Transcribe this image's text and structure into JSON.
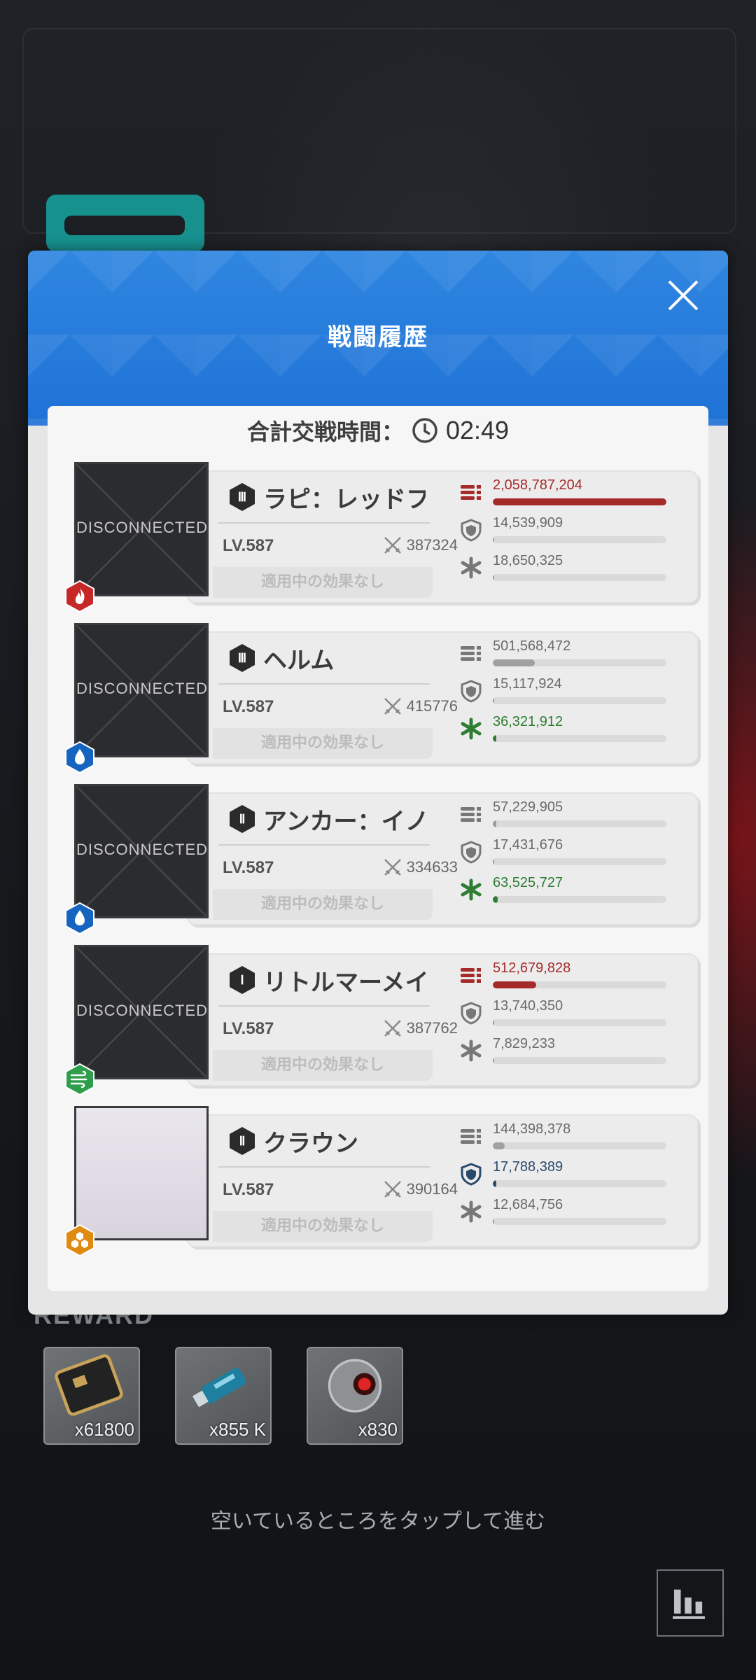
{
  "modal": {
    "title": "戦闘履歴",
    "total_time_label": "合計交戦時間：",
    "total_time_value": "02:49"
  },
  "characters": [
    {
      "name": "ラピ：レッドフ",
      "burst": "Ⅲ",
      "element": "fire",
      "level": "LV.587",
      "power": "387324",
      "effect": "適用中の効果なし",
      "portrait_status": "DISCONNECTED",
      "damage": "2,058,787,204",
      "damage_fraction": 1.0,
      "damage_taken": "14,539,909",
      "damage_taken_fraction": 0.0,
      "healing": "18,650,325",
      "healing_fraction": 0.0,
      "highlight": "damage"
    },
    {
      "name": "ヘルム",
      "burst": "Ⅲ",
      "element": "water",
      "level": "LV.587",
      "power": "415776",
      "effect": "適用中の効果なし",
      "portrait_status": "DISCONNECTED",
      "damage": "501,568,472",
      "damage_fraction": 0.24,
      "damage_taken": "15,117,924",
      "damage_taken_fraction": 0.0,
      "healing": "36,321,912",
      "healing_fraction": 0.01,
      "highlight": "healing"
    },
    {
      "name": "アンカー：イノ",
      "burst": "Ⅱ",
      "element": "water",
      "level": "LV.587",
      "power": "334633",
      "effect": "適用中の効果なし",
      "portrait_status": "DISCONNECTED",
      "damage": "57,229,905",
      "damage_fraction": 0.02,
      "damage_taken": "17,431,676",
      "damage_taken_fraction": 0.0,
      "healing": "63,525,727",
      "healing_fraction": 0.03,
      "highlight": "healing"
    },
    {
      "name": "リトルマーメイ",
      "burst": "Ⅰ",
      "element": "wind",
      "level": "LV.587",
      "power": "387762",
      "effect": "適用中の効果なし",
      "portrait_status": "DISCONNECTED",
      "damage": "512,679,828",
      "damage_fraction": 0.25,
      "damage_taken": "13,740,350",
      "damage_taken_fraction": 0.0,
      "healing": "7,829,233",
      "healing_fraction": 0.0,
      "highlight": "damage"
    },
    {
      "name": "クラウン",
      "burst": "Ⅱ",
      "element": "iron",
      "level": "LV.587",
      "power": "390164",
      "effect": "適用中の効果なし",
      "portrait_status": "",
      "damage": "144,398,378",
      "damage_fraction": 0.07,
      "damage_taken": "17,788,389",
      "damage_taken_fraction": 0.01,
      "healing": "12,684,756",
      "healing_fraction": 0.0,
      "highlight": "damage_taken"
    }
  ],
  "reward": {
    "label": "REWARD",
    "items": [
      {
        "icon": "credit-card-icon",
        "count": "x61800"
      },
      {
        "icon": "usb-drive-icon",
        "count": "x855 K"
      },
      {
        "icon": "core-orb-icon",
        "count": "x830"
      }
    ]
  },
  "tap_hint": "空いているところをタップして進む",
  "colors": {
    "header_blue": "#2f86e0",
    "damage_red": "#a52a2a",
    "healing_green": "#2e7d32",
    "shield_navy": "#2a4a6b",
    "fire": "#c62828",
    "water": "#1565c0",
    "wind": "#2e9e4a",
    "iron": "#e08a12"
  }
}
